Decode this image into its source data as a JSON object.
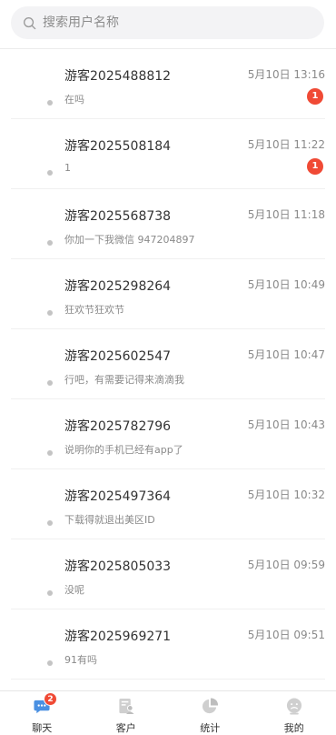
{
  "search": {
    "placeholder": "搜索用户名称",
    "icon": "search-icon"
  },
  "conversations": [
    {
      "name": "游客2025488812",
      "time": "5月10日 13:16",
      "message": "在吗",
      "unread": "1"
    },
    {
      "name": "游客2025508184",
      "time": "5月10日 11:22",
      "message": "1",
      "unread": "1"
    },
    {
      "name": "游客2025568738",
      "time": "5月10日 11:18",
      "message": "你加一下我微信  947204897",
      "unread": ""
    },
    {
      "name": "游客2025298264",
      "time": "5月10日 10:49",
      "message": "狂欢节狂欢节",
      "unread": ""
    },
    {
      "name": "游客2025602547",
      "time": "5月10日 10:47",
      "message": "行吧，有需要记得来滴滴我",
      "unread": ""
    },
    {
      "name": "游客2025782796",
      "time": "5月10日 10:43",
      "message": "说明你的手机已经有app了",
      "unread": ""
    },
    {
      "name": "游客2025497364",
      "time": "5月10日 10:32",
      "message": "下载得就退出美区ID",
      "unread": ""
    },
    {
      "name": "游客2025805033",
      "time": "5月10日 09:59",
      "message": "没呢",
      "unread": ""
    },
    {
      "name": "游客2025969271",
      "time": "5月10日 09:51",
      "message": "91有吗",
      "unread": ""
    }
  ],
  "tabbar": {
    "tabs": [
      {
        "label": "聊天",
        "icon": "chat-icon",
        "badge": "2",
        "active": true
      },
      {
        "label": "客户",
        "icon": "customer-icon",
        "badge": "",
        "active": false
      },
      {
        "label": "统计",
        "icon": "pie-chart-icon",
        "badge": "",
        "active": false
      },
      {
        "label": "我的",
        "icon": "profile-icon",
        "badge": "",
        "active": false
      }
    ]
  },
  "colors": {
    "badge": "#f04a35",
    "active_tab": "#4a90e2",
    "inactive_tab": "#cfcfcf"
  }
}
